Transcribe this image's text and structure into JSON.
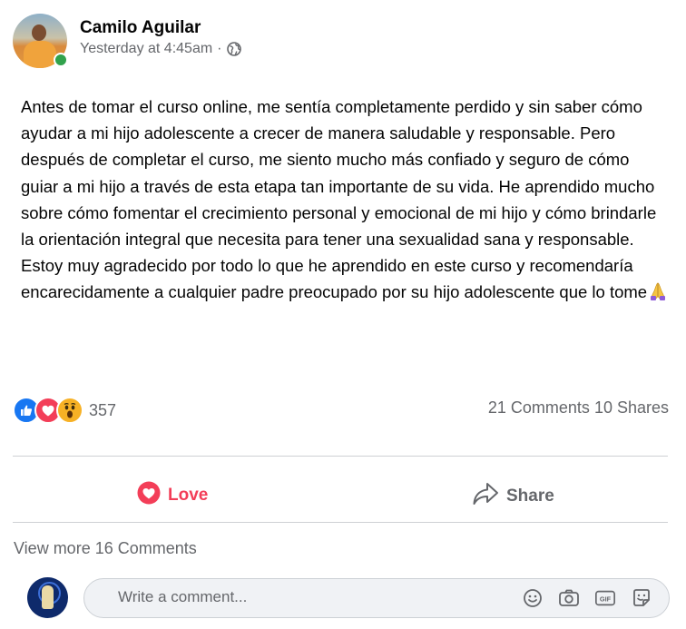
{
  "post": {
    "author": "Camilo Aguilar",
    "timestamp": "Yesterday at 4:45am",
    "separator": "·",
    "privacy_icon": "globe-icon",
    "body": "Antes de tomar el curso online, me sentía completamente perdido y sin saber cómo ayudar a mi hijo adolescente a crecer de manera saludable y responsable. Pero después de completar el curso, me siento mucho más confiado y seguro de cómo guiar a mi hijo a través de esta etapa tan importante de su vida. He aprendido mucho sobre cómo fomentar el crecimiento personal y emocional de mi hijo y cómo brindarle la orientación integral que necesita para tener una sexualidad sana y responsable. Estoy muy agradecido por todo lo que he aprendido en este curso y recomendaría encarecidamente a cualquier padre preocupado por su hijo adolescente que lo tome",
    "body_emoji": "folded-hands-emoji"
  },
  "reactions": {
    "types": [
      "like",
      "love",
      "wow"
    ],
    "count": "357"
  },
  "stats": {
    "comments": "21 Comments",
    "shares": "10 Shares"
  },
  "actions": {
    "love_label": "Love",
    "share_label": "Share"
  },
  "comments": {
    "view_more": "View more 16 Comments",
    "input_placeholder": "Write a comment...",
    "input_value": "",
    "icons": [
      "emoji-icon",
      "camera-icon",
      "gif-icon",
      "sticker-icon"
    ]
  },
  "colors": {
    "like": "#1877f2",
    "love": "#f33e58",
    "wow": "#f7b125",
    "secondary_text": "#65676b",
    "online": "#31a24c"
  }
}
